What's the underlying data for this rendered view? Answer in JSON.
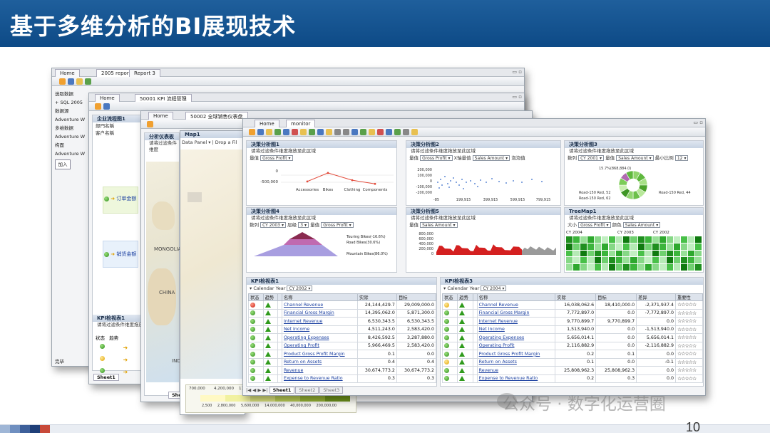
{
  "slide": {
    "title": "基于多维分析的BI展现技术",
    "page_number": "10",
    "watermark": "公众号 · 数字化运营圈"
  },
  "win1": {
    "tabs": [
      "Home",
      "2005 report",
      "Report 3"
    ],
    "left_items": [
      "选取数据",
      "+ SQL 2005",
      "数据源",
      "Adventure W",
      "多维数据",
      "Adventure W",
      "构面",
      "Adventure W",
      "加入"
    ],
    "status": "完毕"
  },
  "win2": {
    "tabs": [
      "Home",
      "50001 KPI 流程管理"
    ],
    "title": "企业流程图1",
    "fields": [
      "部門名稱",
      "客户名稱"
    ],
    "flow_items": [
      "订单金额",
      "销货金额"
    ],
    "kpi_title": "KPI检视表1",
    "kpi_hint": "请将过滤条件维度拖放",
    "kpi_cols": [
      "状态",
      "趋势"
    ],
    "sheet": "Sheet1"
  },
  "win3": {
    "tabs": [
      "Home",
      "50002 全球销售仪表盘"
    ],
    "title": "分析仪表板",
    "hint": "请将过滤条件维度",
    "countries": [
      "MONGOLIA",
      "CHINA",
      "IND"
    ],
    "sheet": "She"
  },
  "win4": {
    "map_title": "Map1",
    "map_toolbar": "Data Panel ▾ | Drop a Fil",
    "legend_values": [
      "2,500",
      "2,800,000",
      "5,600,000",
      "14,000,000",
      "40,000,000",
      "200,000,00"
    ],
    "legend_top": [
      "700,000",
      "4,200,000",
      "11"
    ]
  },
  "main": {
    "tabs": [
      "Home",
      "monitor"
    ],
    "hint": "请将过滤条件维度拖放至此区域",
    "p1": {
      "title": "决策分析图1",
      "measure_label": "量值",
      "measure": "Gross Profit",
      "yticks": [
        "0",
        "-500,000"
      ],
      "categories": [
        "Accessories",
        "Bikes",
        "Clothing",
        "Components"
      ]
    },
    "p2": {
      "title": "决策分析图2",
      "measure_label": "量值",
      "measure": "Gross Profit",
      "x_label": "X轴量值",
      "x_measure": "Sales Amount",
      "bubble_label": "泡泡值",
      "yticks": [
        "200,000",
        "100,000",
        "0",
        "-100,000",
        "-200,000"
      ],
      "xticks": [
        "-85",
        "199,915",
        "399,915",
        "599,915",
        "799,915"
      ]
    },
    "p3": {
      "title": "决策分析图3",
      "row_label": "数列",
      "row_value": "CY 2001",
      "measure_label": "量值",
      "measure": "Sales Amount",
      "ratio_label": "最小比例",
      "ratio": "12",
      "labels": [
        "15.7%(868,884.0)",
        "Road-150 Red, 52",
        "Road-150 Red, 62",
        "Road-150 Red, 44"
      ]
    },
    "p4": {
      "title": "决策分析图4",
      "row_label": "数列",
      "row_value": "CY 2003",
      "level_label": "层级",
      "level": "3",
      "measure_label": "量值",
      "measure": "Gross Profit",
      "slices": [
        "Touring Bikes(-16.6%)",
        "Road Bikes(30.6%)",
        "Mountain Bikes(86.0%)"
      ]
    },
    "p5": {
      "title": "决策分析图5",
      "measure_label": "量值",
      "measure": "Sales Amount",
      "yticks": [
        "800,000",
        "600,000",
        "400,000",
        "200,000",
        "0"
      ]
    },
    "p6": {
      "title": "TreeMap1",
      "size_label": "大小",
      "size": "Gross Profit",
      "color_label": "颜色",
      "color": "Sales Amount",
      "years": [
        "CY 2004",
        "CY 2003",
        "CY 2002"
      ]
    },
    "kpi1": {
      "title": "KPI检视表1",
      "filter_label": "Calendar Year",
      "filter_value": "CY 2002",
      "headers": [
        "状态",
        "趋势",
        "",
        "名称",
        "实际",
        "目标"
      ],
      "rows": [
        {
          "status": "red",
          "name": "Channel Revenue",
          "actual": "24,144,429.7",
          "target": "29,009,000.0"
        },
        {
          "status": "green",
          "name": "Financial Gross Margin",
          "actual": "14,395,062.0",
          "target": "5,871,300.0"
        },
        {
          "status": "green",
          "name": "Internet Revenue",
          "actual": "6,530,343.5",
          "target": "6,530,343.5"
        },
        {
          "status": "green",
          "name": "Net Income",
          "actual": "4,511,243.0",
          "target": "2,583,420.0"
        },
        {
          "status": "green",
          "name": "Operating Expenses",
          "actual": "8,426,592.5",
          "target": "3,287,880.0"
        },
        {
          "status": "green",
          "name": "Operating Profit",
          "actual": "5,966,469.5",
          "target": "2,583,420.0"
        },
        {
          "status": "green",
          "name": "Product Gross Profit Margin",
          "actual": "0.1",
          "target": "0.0"
        },
        {
          "status": "green",
          "name": "Return on Assets",
          "actual": "0.4",
          "target": "0.4"
        },
        {
          "status": "green",
          "name": "Revenue",
          "actual": "30,674,773.2",
          "target": "30,674,773.2"
        },
        {
          "status": "green",
          "name": "Expense to Revenue Ratio",
          "actual": "0.3",
          "target": "0.3"
        }
      ]
    },
    "kpi3": {
      "title": "KPI检视表3",
      "filter_label": "Calendar Year",
      "filter_value": "CY 2004",
      "headers": [
        "状态",
        "趋势",
        "",
        "名称",
        "实际",
        "目标",
        "差异",
        "重要性"
      ],
      "rows": [
        {
          "status": "yellow",
          "name": "Channel Revenue",
          "actual": "16,038,062.6",
          "target": "18,410,000.0",
          "diff": "-2,371,937.4",
          "stars": "☆☆☆☆☆"
        },
        {
          "status": "green",
          "name": "Financial Gross Margin",
          "actual": "7,772,897.0",
          "target": "0.0",
          "diff": "-7,772,897.0",
          "stars": "☆☆☆☆☆"
        },
        {
          "status": "green",
          "name": "Internet Revenue",
          "actual": "9,770,899.7",
          "target": "9,770,899.7",
          "diff": "0.0",
          "stars": "☆☆☆☆☆"
        },
        {
          "status": "green",
          "name": "Net Income",
          "actual": "1,513,940.0",
          "target": "0.0",
          "diff": "-1,513,940.0",
          "stars": "☆☆☆☆☆"
        },
        {
          "status": "green",
          "name": "Operating Expenses",
          "actual": "5,656,014.1",
          "target": "0.0",
          "diff": "5,656,014.1",
          "stars": "☆☆☆☆☆"
        },
        {
          "status": "green",
          "name": "Operating Profit",
          "actual": "2,116,882.9",
          "target": "0.0",
          "diff": "-2,116,882.9",
          "stars": "☆☆☆☆☆"
        },
        {
          "status": "green",
          "name": "Product Gross Profit Margin",
          "actual": "0.2",
          "target": "0.1",
          "diff": "0.0",
          "stars": "☆☆☆☆☆"
        },
        {
          "status": "yellow",
          "name": "Return on Assets",
          "actual": "0.1",
          "target": "0.0",
          "diff": "-0.1",
          "stars": "☆☆☆☆☆"
        },
        {
          "status": "green",
          "name": "Revenue",
          "actual": "25,808,962.3",
          "target": "25,808,962.3",
          "diff": "0.0",
          "stars": "☆☆☆☆☆"
        },
        {
          "status": "green",
          "name": "Expense to Revenue Ratio",
          "actual": "0.2",
          "target": "0.3",
          "diff": "0.0",
          "stars": "☆☆☆☆☆"
        }
      ]
    },
    "sheets": [
      "Sheet1",
      "Sheet2",
      "Sheet3"
    ]
  },
  "chart_data": [
    {
      "type": "line",
      "categories": [
        "Accessories",
        "Bikes",
        "Clothing",
        "Components"
      ],
      "values": [
        -350000,
        0,
        -300000,
        -450000
      ]
    },
    {
      "type": "scatter"
    },
    {
      "type": "pie"
    },
    {
      "type": "bar"
    },
    {
      "type": "area"
    },
    {
      "type": "heatmap"
    }
  ]
}
